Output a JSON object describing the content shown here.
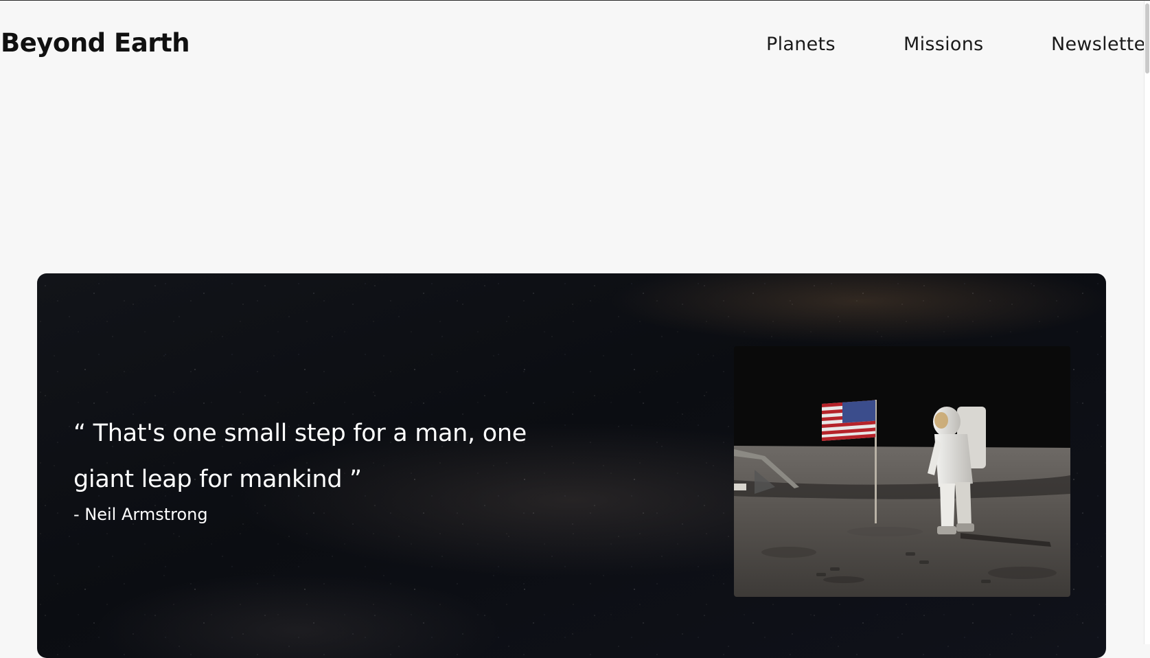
{
  "header": {
    "logo": "Beyond Earth",
    "nav": [
      {
        "label": "Planets"
      },
      {
        "label": "Missions"
      },
      {
        "label": "Newsletter"
      }
    ]
  },
  "hero": {
    "quote": "“ That's one small step for a man, one giant leap for mankind ”",
    "author": "- Neil Armstrong",
    "photo_subject": "astronaut-with-flag-on-moon"
  },
  "colors": {
    "page_background": "#f7f7f7",
    "text_dark": "#111111",
    "hero_background": "#0b0d12",
    "hero_text": "#ffffff"
  }
}
